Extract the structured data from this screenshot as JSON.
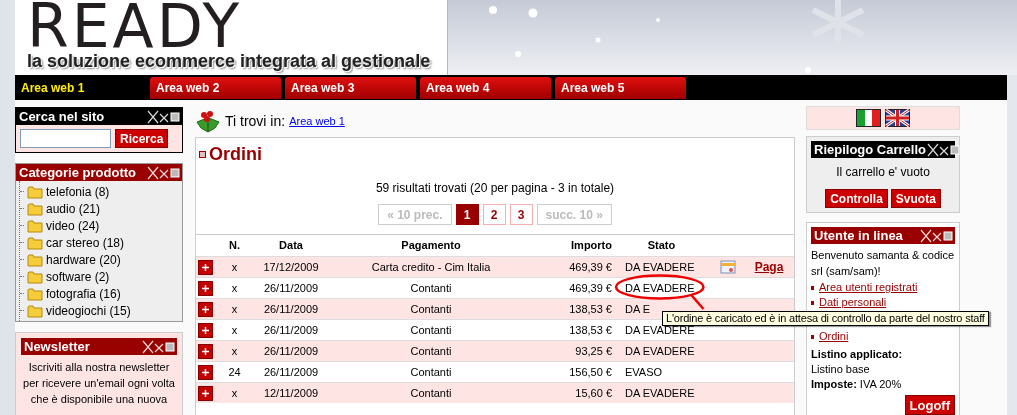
{
  "header": {
    "logo": "READY",
    "tagline": "la soluzione ecommerce integrata al gestionale"
  },
  "nav_tabs": [
    {
      "label": "Area web 1",
      "selected": true
    },
    {
      "label": "Area web 2",
      "selected": false
    },
    {
      "label": "Area web 3",
      "selected": false
    },
    {
      "label": "Area web 4",
      "selected": false
    },
    {
      "label": "Area web 5",
      "selected": false
    }
  ],
  "search_box": {
    "title": "Cerca nel sito",
    "button": "Ricerca"
  },
  "categories": {
    "title": "Categorie prodotto",
    "items": [
      "telefonia (8)",
      "audio (21)",
      "video (24)",
      "car stereo (18)",
      "hardware (20)",
      "software (2)",
      "fotografia (16)",
      "videogiochi (15)"
    ]
  },
  "newsletter": {
    "title": "Newsletter",
    "lines": [
      "Iscriviti alla nostra newsletter",
      "per ricevere un'email ogni volta",
      "che è disponibile una nuova"
    ]
  },
  "breadcrumb": {
    "label": "Ti trovi in:",
    "link": "Area web 1"
  },
  "orders": {
    "title": "Ordini",
    "summary": "59 risultati trovati (20 per pagina - 3 in totale)",
    "pagination": [
      {
        "label": "« 10 prec.",
        "kind": "nav",
        "selected": false,
        "disabled": true
      },
      {
        "label": "1",
        "kind": "page",
        "selected": true,
        "disabled": false
      },
      {
        "label": "2",
        "kind": "page",
        "selected": false,
        "disabled": false
      },
      {
        "label": "3",
        "kind": "page",
        "selected": false,
        "disabled": false
      },
      {
        "label": "succ. 10 »",
        "kind": "nav",
        "selected": false,
        "disabled": true
      }
    ],
    "columns": [
      "N.",
      "Data",
      "Pagamento",
      "Importo",
      "Stato"
    ],
    "rows": [
      {
        "n": "x",
        "date": "17/12/2009",
        "payment": "Carta credito - Cim Italia",
        "amount": "469,39 €",
        "status": "DA EVADERE",
        "pay_link": "Paga",
        "circled": false
      },
      {
        "n": "x",
        "date": "26/11/2009",
        "payment": "Contanti",
        "amount": "469,39 €",
        "status": "DA EVADERE",
        "circled": true
      },
      {
        "n": "x",
        "date": "26/11/2009",
        "payment": "Contanti",
        "amount": "138,53 €",
        "status": "DA E",
        "circled": false
      },
      {
        "n": "x",
        "date": "26/11/2009",
        "payment": "Contanti",
        "amount": "138,53 €",
        "status": "DA EVADERE",
        "circled": false
      },
      {
        "n": "x",
        "date": "26/11/2009",
        "payment": "Contanti",
        "amount": "93,25 €",
        "status": "DA EVADERE",
        "circled": false
      },
      {
        "n": "24",
        "date": "26/11/2009",
        "payment": "Contanti",
        "amount": "156,50 €",
        "status": "EVASO",
        "circled": false
      },
      {
        "n": "x",
        "date": "12/11/2009",
        "payment": "Contanti",
        "amount": "15,60 €",
        "status": "DA EVADERE",
        "circled": false
      }
    ]
  },
  "tooltip": "L'ordine è caricato ed è in attesa di controllo da parte del nostro staff",
  "cart": {
    "title": "Riepilogo Carrello",
    "message": "Il carrello e' vuoto",
    "buttons": [
      "Controlla",
      "Svuota"
    ]
  },
  "user": {
    "title": "Utente in linea",
    "welcome": "Benvenuto samanta & codice srl (sam/sam)!",
    "links": [
      "Area utenti registrati",
      "Dati personali",
      "Ordini"
    ],
    "price_list_label": "Listino applicato:",
    "price_list": "Listino base",
    "tax_label": "Imposte:",
    "tax": "IVA 20%",
    "logoff": "Logoff"
  }
}
